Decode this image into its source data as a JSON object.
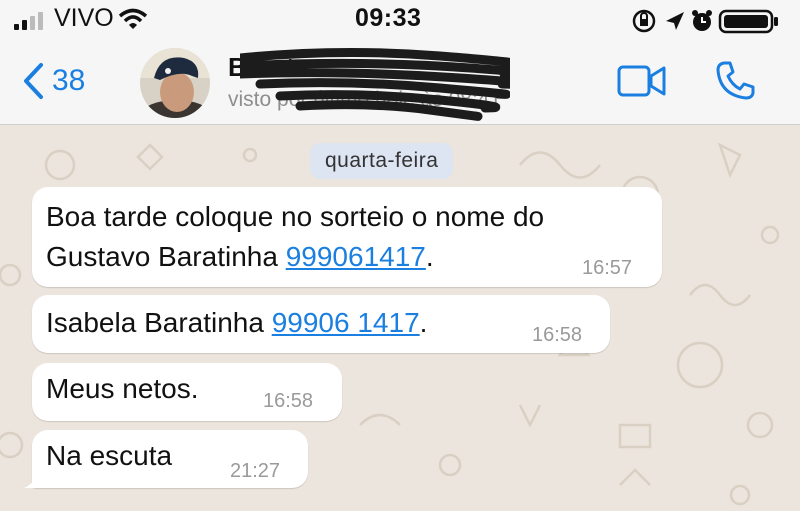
{
  "status_bar": {
    "carrier": "VIVO",
    "time": "09:33"
  },
  "header": {
    "back_count": "38",
    "contact_name": "Barata",
    "last_seen": "visto por último hoje às 08:41"
  },
  "chat": {
    "date_chip": "quarta-feira",
    "messages": [
      {
        "line1": "Boa tarde coloque no sorteio o nome do",
        "line2_prefix": "Gustavo Baratinha ",
        "link": "999061417",
        "suffix": ".",
        "time": "16:57"
      },
      {
        "prefix": "Isabela Baratinha ",
        "link": "99906 1417",
        "suffix": ".",
        "time": "16:58"
      },
      {
        "text": "Meus netos.",
        "time": "16:58"
      },
      {
        "text": "Na escuta",
        "time": "21:27"
      }
    ]
  },
  "colors": {
    "accent": "#1a7fe0",
    "bubble": "#ffffff",
    "wallpaper": "#ece5dd",
    "date_chip": "#dde4f2"
  },
  "icons": [
    "signal-icon",
    "wifi-icon",
    "lock-rotation-icon",
    "location-icon",
    "alarm-icon",
    "battery-icon",
    "back-chevron-icon",
    "video-call-icon",
    "phone-call-icon"
  ]
}
